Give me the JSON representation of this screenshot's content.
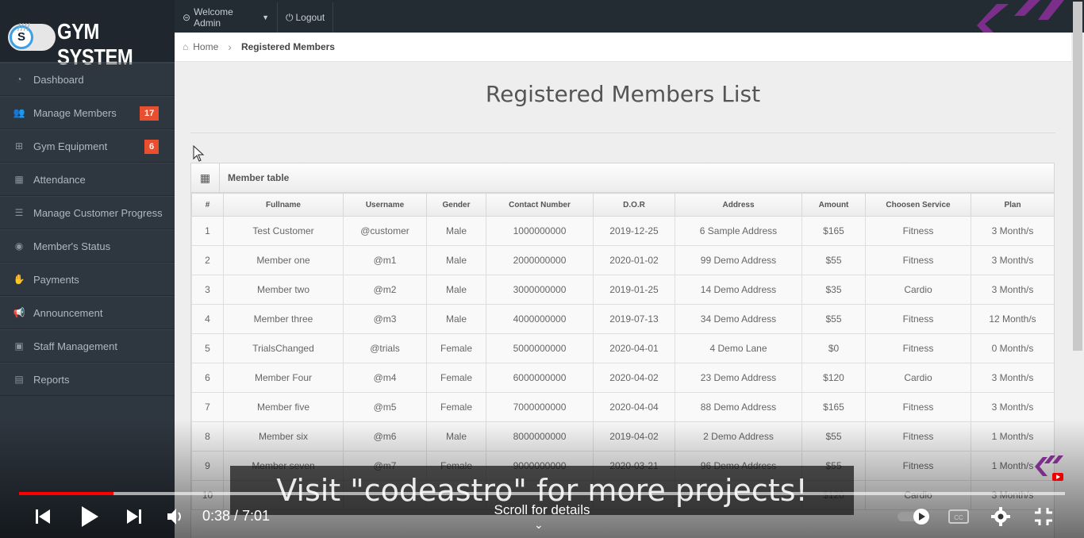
{
  "brand": {
    "badge_letter": "S",
    "stripes": "////",
    "name": "GYM SYSTEM"
  },
  "sidebar": {
    "items": [
      {
        "label": "Dashboard",
        "icon": "dashboard-icon",
        "glyph": "◔"
      },
      {
        "label": "Manage Members",
        "icon": "group-icon",
        "glyph": "👥",
        "badge": "17"
      },
      {
        "label": "Gym Equipment",
        "icon": "dumbbell-icon",
        "glyph": "⊞",
        "badge": "6"
      },
      {
        "label": "Attendance",
        "icon": "calendar-icon",
        "glyph": "▦"
      },
      {
        "label": "Manage Customer Progress",
        "icon": "list-icon",
        "glyph": "☰"
      },
      {
        "label": "Member's Status",
        "icon": "eye-icon",
        "glyph": "◉"
      },
      {
        "label": "Payments",
        "icon": "hand-icon",
        "glyph": "✋"
      },
      {
        "label": "Announcement",
        "icon": "bullhorn-icon",
        "glyph": "📢"
      },
      {
        "label": "Staff Management",
        "icon": "briefcase-icon",
        "glyph": "▣"
      },
      {
        "label": "Reports",
        "icon": "file-icon",
        "glyph": "▤"
      }
    ]
  },
  "topbar": {
    "welcome_label": "Welcome Admin",
    "welcome_icon": "⊝",
    "logout_label": "Logout",
    "logout_icon": "⏻"
  },
  "breadcrumb": {
    "home": "Home",
    "current": "Registered Members"
  },
  "page": {
    "title": "Registered Members List"
  },
  "table": {
    "panel_title": "Member table",
    "columns": [
      "#",
      "Fullname",
      "Username",
      "Gender",
      "Contact Number",
      "D.O.R",
      "Address",
      "Amount",
      "Choosen Service",
      "Plan"
    ],
    "rows": [
      [
        "1",
        "Test Customer",
        "@customer",
        "Male",
        "1000000000",
        "2019-12-25",
        "6 Sample Address",
        "$165",
        "Fitness",
        "3 Month/s"
      ],
      [
        "2",
        "Member one",
        "@m1",
        "Male",
        "2000000000",
        "2020-01-02",
        "99 Demo Address",
        "$55",
        "Fitness",
        "3 Month/s"
      ],
      [
        "3",
        "Member two",
        "@m2",
        "Male",
        "3000000000",
        "2019-01-25",
        "14 Demo Address",
        "$35",
        "Cardio",
        "3 Month/s"
      ],
      [
        "4",
        "Member three",
        "@m3",
        "Male",
        "4000000000",
        "2019-07-13",
        "34 Demo Address",
        "$55",
        "Fitness",
        "12 Month/s"
      ],
      [
        "5",
        "TrialsChanged",
        "@trials",
        "Female",
        "5000000000",
        "2020-04-01",
        "4 Demo Lane",
        "$0",
        "Fitness",
        "0 Month/s"
      ],
      [
        "6",
        "Member Four",
        "@m4",
        "Female",
        "6000000000",
        "2020-04-02",
        "23 Demo Address",
        "$120",
        "Cardio",
        "3 Month/s"
      ],
      [
        "7",
        "Member five",
        "@m5",
        "Female",
        "7000000000",
        "2020-04-04",
        "88 Demo Address",
        "$165",
        "Fitness",
        "3 Month/s"
      ],
      [
        "8",
        "Member six",
        "@m6",
        "Male",
        "8000000000",
        "2019-04-02",
        "2 Demo Address",
        "$55",
        "Fitness",
        "1 Month/s"
      ],
      [
        "9",
        "Member seven",
        "@m7",
        "Female",
        "9000000000",
        "2020-03-21",
        "96 Demo Address",
        "$55",
        "Fitness",
        "1 Month/s"
      ],
      [
        "10",
        "",
        "",
        "",
        "",
        "",
        "",
        "$120",
        "Cardio",
        "3 Month/s"
      ]
    ]
  },
  "video": {
    "caption": "Visit \"codeastro\" for more projects!",
    "time": "0:38 / 7:01",
    "scroll_hint": "Scroll for details",
    "progress_fraction": 0.09,
    "progress_color": "#ff0000"
  },
  "colors": {
    "sidebar_bg": "#2e363f",
    "topbar_bg": "#232b33",
    "badge": "#e94e2f",
    "accent": "#7b2f8a"
  }
}
